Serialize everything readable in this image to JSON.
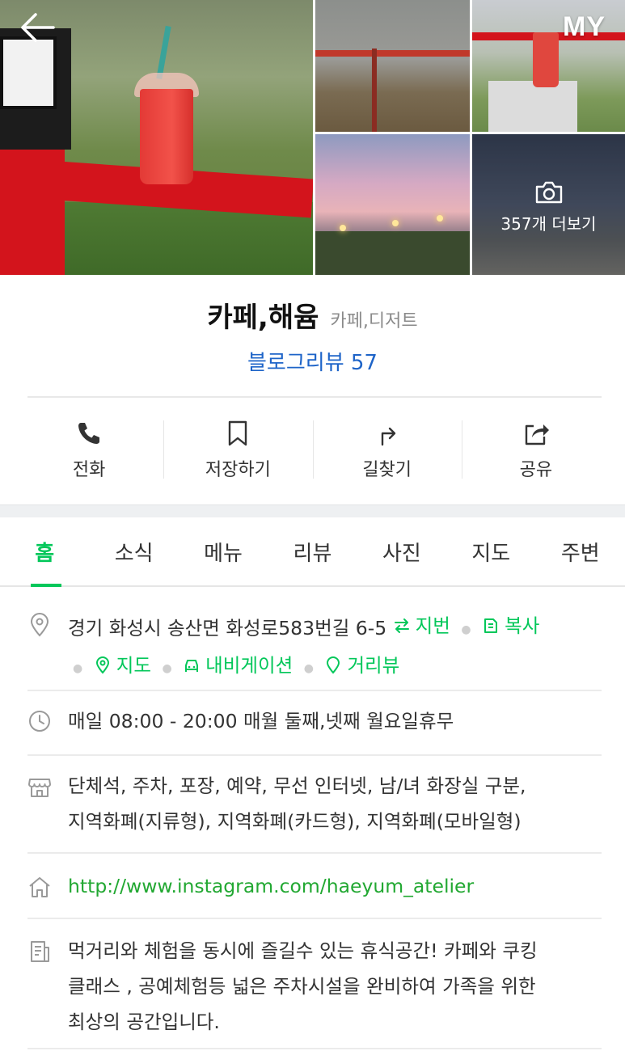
{
  "header": {
    "my_label": "MY",
    "more_photos_label": "357개 더보기"
  },
  "place": {
    "name": "카페,해윰",
    "category": "카페,디저트",
    "blog_review": "블로그리뷰 57"
  },
  "actions": [
    {
      "label": "전화",
      "icon": "phone-icon"
    },
    {
      "label": "저장하기",
      "icon": "bookmark-icon"
    },
    {
      "label": "길찾기",
      "icon": "directions-icon"
    },
    {
      "label": "공유",
      "icon": "share-icon"
    }
  ],
  "tabs": [
    "홈",
    "소식",
    "메뉴",
    "리뷰",
    "사진",
    "지도",
    "주변"
  ],
  "info": {
    "address": "경기 화성시 송산면 화성로583번길 6-5",
    "address_links": {
      "lot_number": "지번",
      "copy": "복사",
      "map": "지도",
      "navigation": "내비게이션",
      "street_view": "거리뷰"
    },
    "hours": "매일 08:00 - 20:00 매월 둘째,넷째 월요일휴무",
    "amenities_line1": "단체석, 주차, 포장, 예약, 무선 인터넷, 남/녀 화장실 구분,",
    "amenities_line2": "지역화폐(지류형), 지역화폐(카드형), 지역화폐(모바일형)",
    "website": "http://www.instagram.com/haeyum_atelier",
    "description_line1": "먹거리와 체험을 동시에 즐길수 있는 휴식공간! 카페와 쿠킹",
    "description_line2": "클래스 , 공예체험등 넓은 주차시설을 완비하여 가족을 위한",
    "description_line3": "최상의 공간입니다."
  },
  "colors": {
    "accent_green": "#03c75a",
    "link_blue": "#1e64c8",
    "url_green": "#22a832"
  }
}
